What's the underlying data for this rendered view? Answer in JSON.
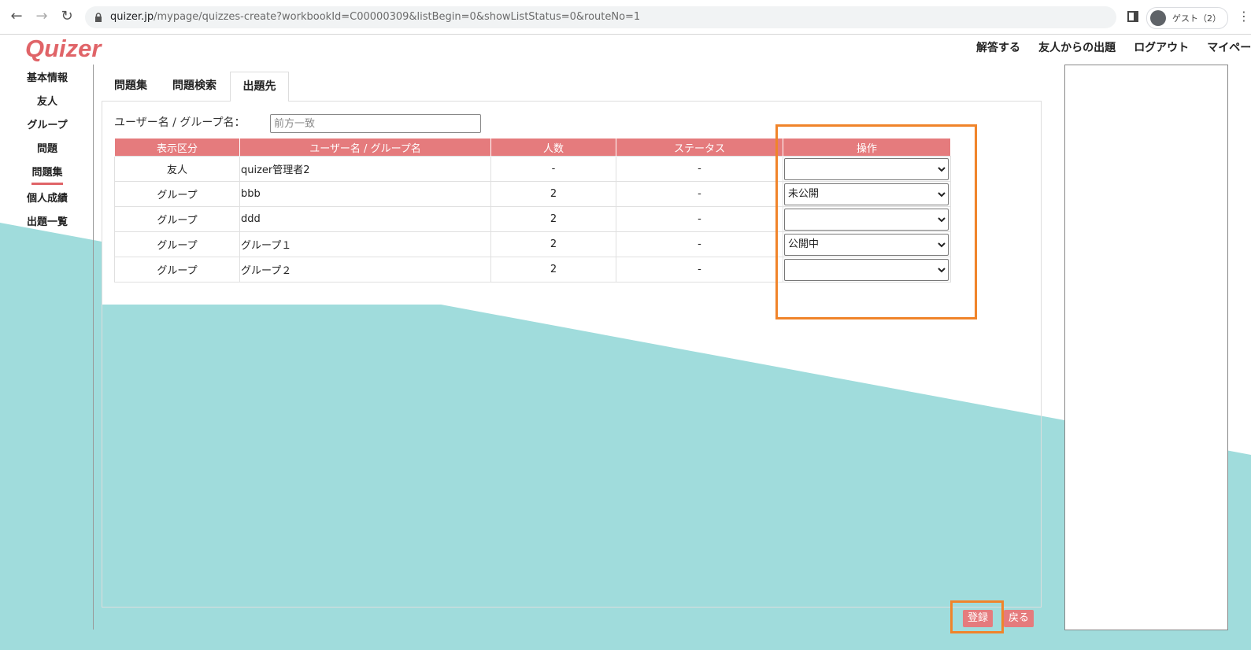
{
  "browser": {
    "url_host": "quizer.jp",
    "url_path": "/mypage/quizzes-create?workbookId=C00000309&listBegin=0&showListStatus=0&routeNo=1",
    "profile_label": "ゲスト（2）",
    "back_icon": "←",
    "forward_icon": "→",
    "reload_icon": "↻",
    "menu_icon": "⋮"
  },
  "header": {
    "logo": "Quizer",
    "nav": [
      "解答する",
      "友人からの出題",
      "ログアウト",
      "マイページ"
    ]
  },
  "left_menu": {
    "items": [
      "基本情報",
      "友人",
      "グループ",
      "問題",
      "問題集",
      "個人成績",
      "出題一覧"
    ],
    "active": "問題集"
  },
  "tabs": [
    "問題集",
    "問題検索",
    "出題先"
  ],
  "active_tab": "出題先",
  "search": {
    "label": "ユーザー名 / グループ名：",
    "placeholder": "前方一致",
    "value": ""
  },
  "table": {
    "headers": [
      "表示区分",
      "ユーザー名 / グループ名",
      "人数",
      "ステータス",
      "操作"
    ],
    "rows": [
      {
        "type": "友人",
        "name": "quizer管理者2",
        "count": "-",
        "status": "-",
        "op": ""
      },
      {
        "type": "グループ",
        "name": "bbb",
        "count": "2",
        "status": "-",
        "op": "未公開"
      },
      {
        "type": "グループ",
        "name": "ddd",
        "count": "2",
        "status": "-",
        "op": ""
      },
      {
        "type": "グループ",
        "name": "グループ１",
        "count": "2",
        "status": "-",
        "op": "公開中"
      },
      {
        "type": "グループ",
        "name": "グループ２",
        "count": "2",
        "status": "-",
        "op": ""
      }
    ]
  },
  "buttons": {
    "register": "登録",
    "back": "戻る"
  },
  "colors": {
    "brand": "#e06468",
    "header_bg": "#e57b7d",
    "teal": "#a0dcdc",
    "highlight": "#f0842a"
  }
}
